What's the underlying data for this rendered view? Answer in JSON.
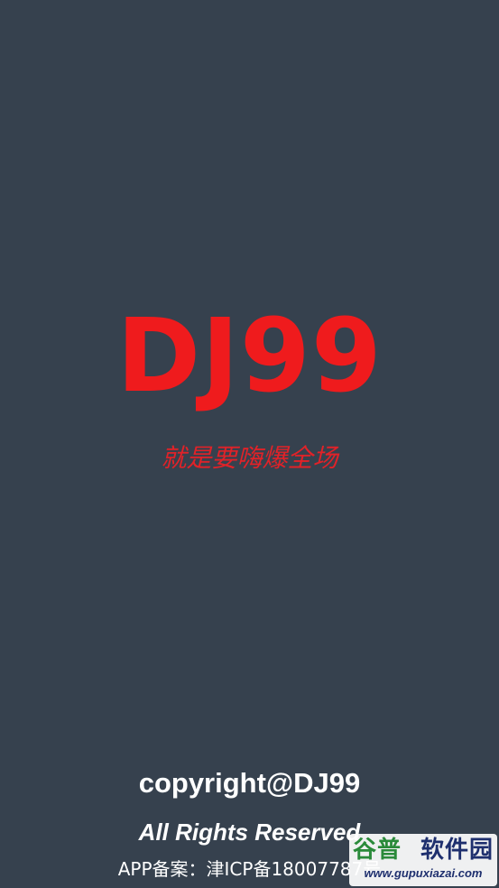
{
  "splash": {
    "app_title": "DJ99",
    "slogan": "就是要嗨爆全场",
    "copyright": "copyright@DJ99",
    "rights": "All Rights Reserved",
    "icp": "APP备案：津ICP备18007787号"
  },
  "watermark": {
    "part1": "谷普",
    "part2": "软件园",
    "url": "www.gupuxiazai.com"
  },
  "colors": {
    "background": "#36414e",
    "title_red": "#ef1b1d",
    "slogan_red": "#e12228",
    "text_white": "#ffffff"
  }
}
